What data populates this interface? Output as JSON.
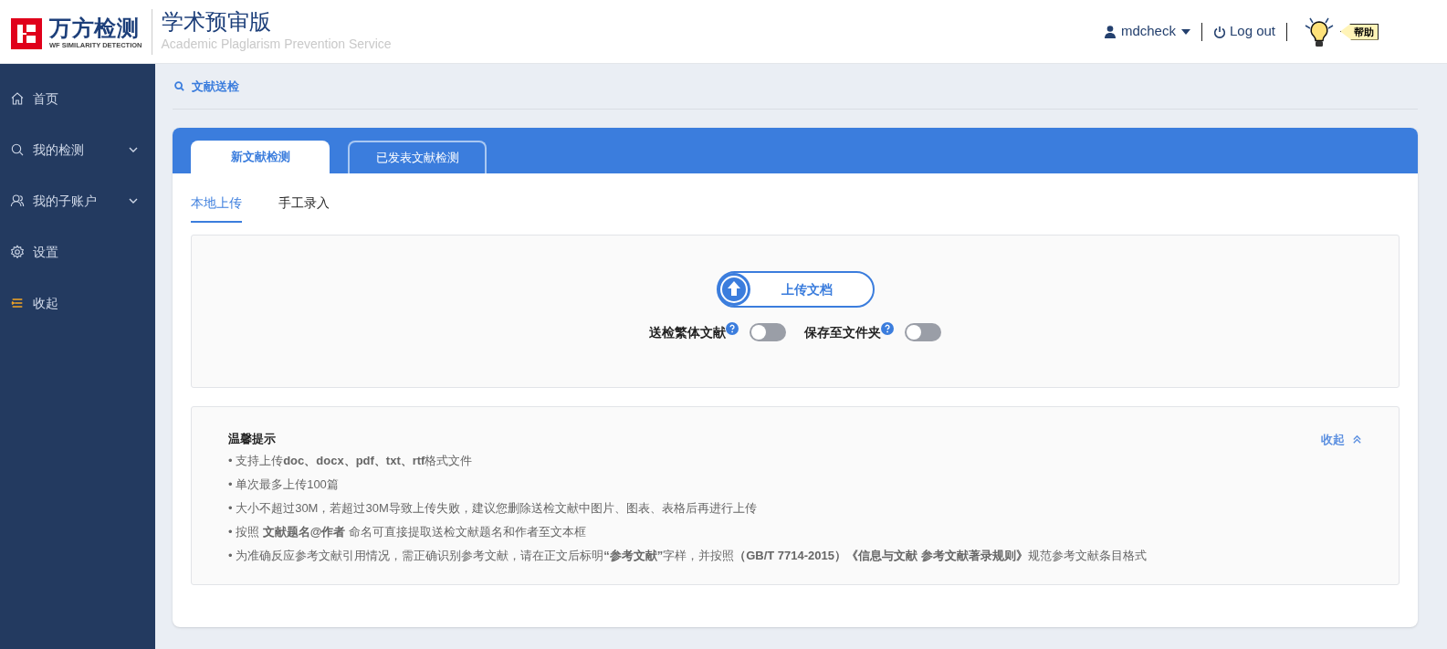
{
  "header": {
    "logo_text": "万方检测",
    "logo_subtext": "WF SIMILARITY DETECTION",
    "product_title": "学术预审版",
    "product_subtitle": "Academic Plaglarism Prevention Service",
    "user": "mdcheck",
    "logout": "Log out",
    "help": "帮助"
  },
  "sidebar": {
    "items": [
      {
        "label": "首页",
        "kind": "link"
      },
      {
        "label": "我的检测",
        "kind": "group",
        "expanded": false
      },
      {
        "label": "我的子账户",
        "kind": "group",
        "expanded": false
      },
      {
        "label": "设置",
        "kind": "link"
      },
      {
        "label": "收起",
        "kind": "collapse"
      }
    ]
  },
  "breadcrumb": "文献送检",
  "tabs": [
    {
      "label": "新文献检测",
      "selected": true
    },
    {
      "label": "已发表文献检测",
      "selected": false
    }
  ],
  "subtabs": [
    {
      "label": "本地上传",
      "selected": true
    },
    {
      "label": "手工录入",
      "selected": false
    }
  ],
  "upload": {
    "button": "上传文档",
    "toggles": [
      {
        "label": "送检繁体文献",
        "on": false
      },
      {
        "label": "保存至文件夹",
        "on": false
      }
    ]
  },
  "tips": {
    "title": "温馨提示",
    "collapse": "收起",
    "expanded": true,
    "lines": [
      "• 支持上传**doc、docx、pdf、txt、rtf**格式文件",
      "• 单次最多上传100篇",
      "• 大小不超过30M，若超过30M导致上传失败，建议您删除送检文献中图片、图表、表格后再进行上传",
      "• 按照 **文献题名@作者** 命名可直接提取送检文献题名和作者至文本框",
      "• 为准确反应参考文献引用情况，需正确识别参考文献，请在正文后标明**“参考文献”**字样，并按照**（GB/T 7714-2015）《信息与文献 参考文献著录规则》**规范参考文献条目格式"
    ]
  }
}
